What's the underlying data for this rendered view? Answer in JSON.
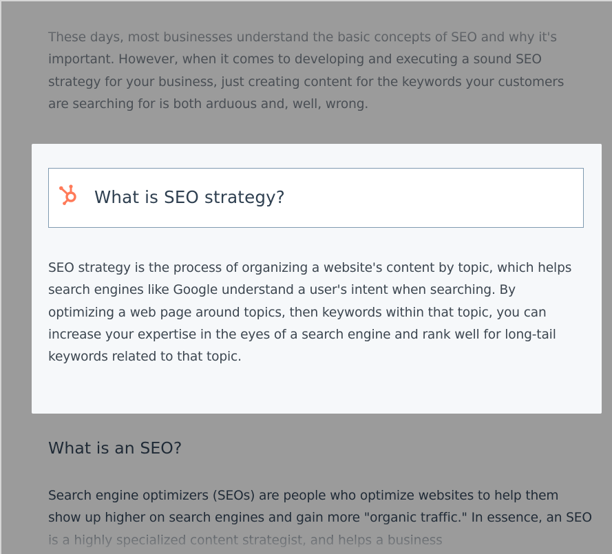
{
  "article": {
    "intro_text": "These days, most businesses understand the basic concepts of SEO and why it's important. However, when it comes to developing and executing a sound SEO strategy for your business, just creating content for the keywords your customers are searching for is both arduous and, well, wrong.",
    "definition_box": {
      "icon": "hubspot-sprocket-icon",
      "icon_color": "#ff7a59",
      "title": "What is SEO strategy?",
      "body": "SEO strategy is the process of organizing a website's content by topic, which helps search engines like Google understand a user's intent when searching. By optimizing a web page around topics, then keywords within that topic, you can increase your expertise in the eyes of a search engine and rank well for long-tail keywords related to that topic."
    },
    "section": {
      "heading": "What is an SEO?",
      "body": "Search engine optimizers (SEOs) are people who optimize websites to help them show up higher on search engines and gain more \"organic traffic.\" In essence, an SEO is a highly specialized content strategist, and helps a business"
    }
  },
  "colors": {
    "overlay": "#9b9b9b",
    "card_background": "#f6f8fa",
    "callout_border": "#7f9ab0",
    "heading_text": "#2e3f50",
    "accent": "#ff7a59"
  }
}
